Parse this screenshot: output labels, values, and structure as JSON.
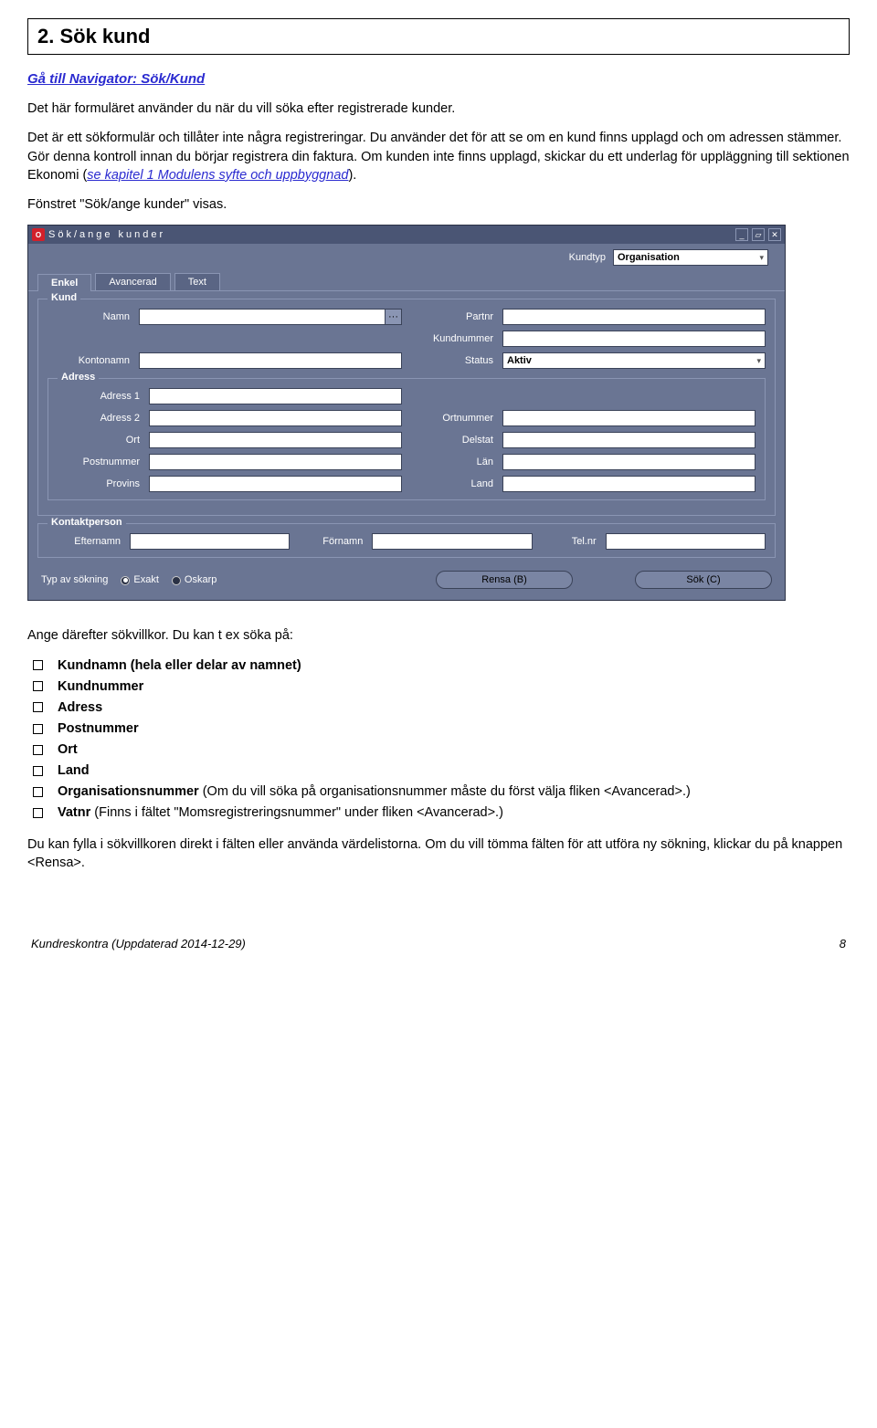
{
  "heading": "2. Sök kund",
  "nav_label": "Gå till Navigator: Sök/Kund",
  "intro_p1": "Det här formuläret använder du när du vill söka efter registrerade kunder.",
  "intro_p2a": "Det är ett sökformulär och tillåter inte några registreringar. Du använder det för att se om en kund finns upplagd och om adressen stämmer. Gör denna kontroll innan du börjar registrera din faktura. Om kunden inte finns upplagd, skickar du ett underlag för uppläggning till sektionen Ekonomi (",
  "intro_link": "se kapitel 1 Modulens syfte och uppbyggnad",
  "intro_p2b": ").",
  "intro_p3": "Fönstret \"Sök/ange kunder\" visas.",
  "window": {
    "title": "Sök/ange kunder",
    "kundtyp_label": "Kundtyp",
    "kundtyp_value": "Organisation",
    "tabs": [
      "Enkel",
      "Avancerad",
      "Text"
    ],
    "group_kund": "Kund",
    "group_adress": "Adress",
    "group_kontakt": "Kontaktperson",
    "labels": {
      "namn": "Namn",
      "kontonamn": "Kontonamn",
      "partnr": "Partnr",
      "kundnummer": "Kundnummer",
      "status": "Status",
      "status_value": "Aktiv",
      "adress1": "Adress 1",
      "adress2": "Adress 2",
      "ort": "Ort",
      "postnummer": "Postnummer",
      "provins": "Provins",
      "ortnummer": "Ortnummer",
      "delstat": "Delstat",
      "lan": "Län",
      "land": "Land",
      "efternamn": "Efternamn",
      "fornamn": "Förnamn",
      "telnr": "Tel.nr"
    },
    "bottom": {
      "typ": "Typ av sökning",
      "exakt": "Exakt",
      "oskarp": "Oskarp",
      "rensa": "Rensa (B)",
      "sok": "Sök (C)"
    }
  },
  "after_p": "Ange därefter sökvillkor. Du kan t ex söka på:",
  "list": {
    "i1": "Kundnamn (hela eller delar av namnet)",
    "i2": "Kundnummer",
    "i3": "Adress",
    "i4": "Postnummer",
    "i5": "Ort",
    "i6": "Land",
    "i7a": "Organisationsnummer",
    "i7b": " (Om du vill söka på organisationsnummer måste du först välja fliken <Avancerad>.)",
    "i8a": "Vatnr",
    "i8b": " (Finns i fältet \"Momsregistreringsnummer\" under fliken <Avancerad>.)"
  },
  "closing": "Du kan fylla i sökvillkoren direkt i fälten eller använda värdelistorna. Om du vill tömma fälten för att utföra ny sökning, klickar du på knappen <Rensa>.",
  "footer_left": "Kundreskontra (Uppdaterad 2014-12-29)",
  "footer_right": "8"
}
